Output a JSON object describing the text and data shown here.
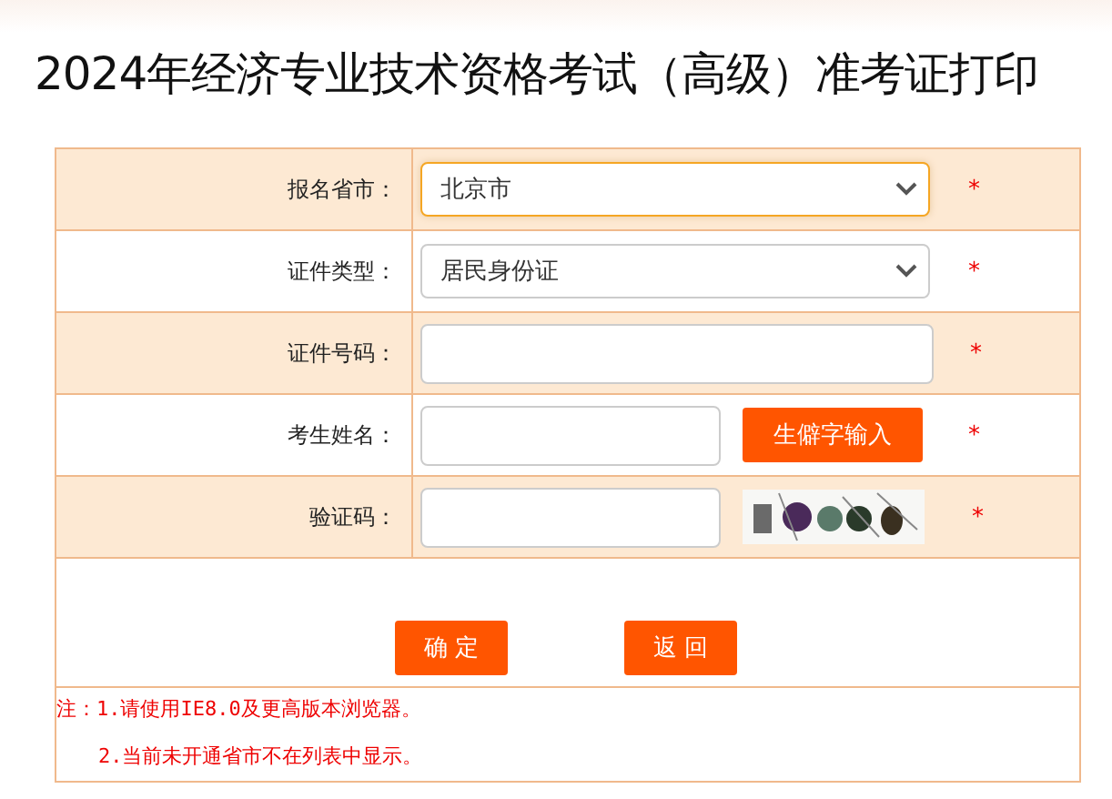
{
  "title": "2024年经济专业技术资格考试（高级）准考证打印",
  "form_rows": [
    {
      "kind": "select",
      "label": "报名省市：",
      "value": "北京市",
      "focused": true,
      "required_mark": "*"
    },
    {
      "kind": "select",
      "label": "证件类型：",
      "value": "居民身份证",
      "focused": false,
      "required_mark": "*"
    },
    {
      "kind": "input",
      "label": "证件号码：",
      "required_mark": "*"
    },
    {
      "kind": "input_button",
      "label": "考生姓名：",
      "button": "生僻字输入",
      "required_mark": "*"
    },
    {
      "kind": "captcha",
      "label": "验证码：",
      "required_mark": "*"
    }
  ],
  "actions": [
    "确 定",
    "返 回"
  ],
  "notes": [
    "注：1.请使用IE8.0及更高版本浏览器。",
    "2.当前未开通省市不在列表中显示。"
  ]
}
